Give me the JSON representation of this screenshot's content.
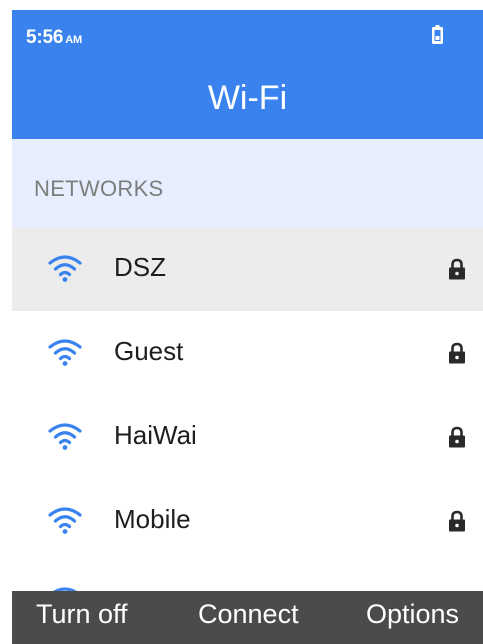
{
  "status_bar": {
    "time": "5:56",
    "ampm": "AM"
  },
  "header": {
    "title": "Wi-Fi"
  },
  "section": {
    "label": "NETWORKS"
  },
  "networks": [
    {
      "name": "DSZ",
      "secured": true,
      "selected": true
    },
    {
      "name": "Guest",
      "secured": true,
      "selected": false
    },
    {
      "name": "HaiWai",
      "secured": true,
      "selected": false
    },
    {
      "name": "Mobile",
      "secured": true,
      "selected": false
    }
  ],
  "softkeys": {
    "left": "Turn off",
    "center": "Connect",
    "right": "Options"
  },
  "icons": {
    "status": "battery-icon",
    "network_signal": "wifi-icon",
    "security": "lock-icon"
  },
  "colors": {
    "header_bg": "#3a83ee",
    "section_bg": "#e7efff",
    "selected_row_bg": "#ececec",
    "wifi_icon": "#3a83ee",
    "softkey_bar_bg": "#4b4b4b"
  }
}
